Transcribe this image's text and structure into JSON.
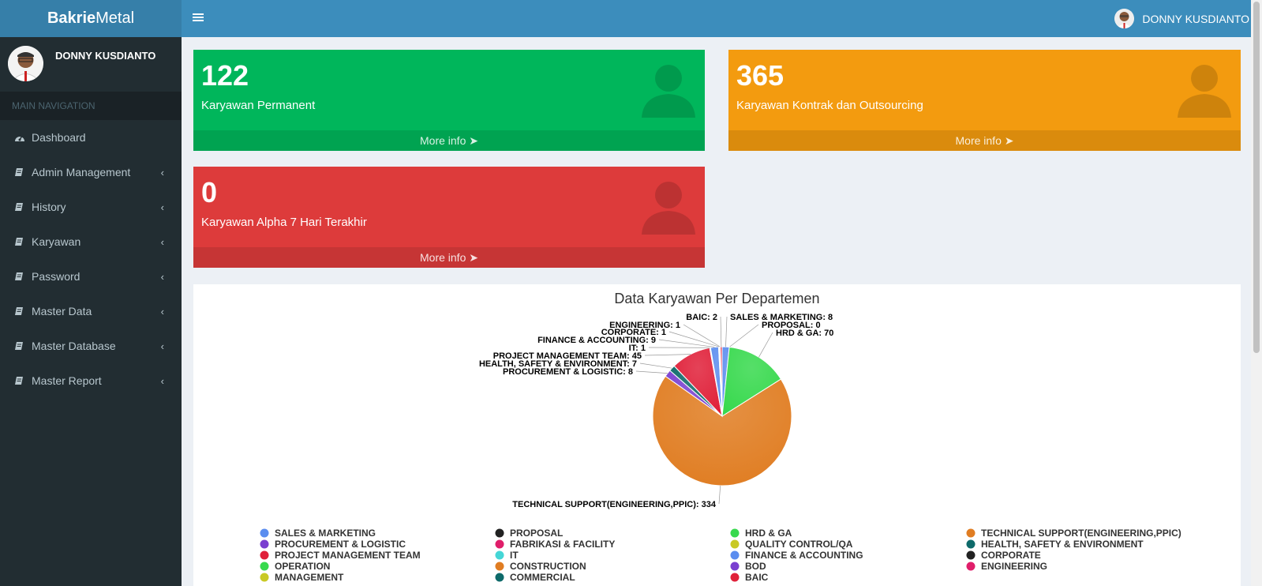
{
  "brand": {
    "bold": "Bakrie",
    "light": "Metal"
  },
  "header": {
    "user_name": "DONNY KUSDIANTO"
  },
  "sidebar": {
    "user_name": "DONNY KUSDIANTO",
    "nav_header": "MAIN NAVIGATION",
    "items": [
      {
        "label": "Dashboard",
        "icon": "dashboard-icon",
        "has_submenu": false
      },
      {
        "label": "Admin Management",
        "icon": "book-icon",
        "has_submenu": true
      },
      {
        "label": "History",
        "icon": "book-icon",
        "has_submenu": true
      },
      {
        "label": "Karyawan",
        "icon": "book-icon",
        "has_submenu": true
      },
      {
        "label": "Password",
        "icon": "book-icon",
        "has_submenu": true
      },
      {
        "label": "Master Data",
        "icon": "book-icon",
        "has_submenu": true
      },
      {
        "label": "Master Database",
        "icon": "book-icon",
        "has_submenu": true
      },
      {
        "label": "Master Report",
        "icon": "book-icon",
        "has_submenu": true
      }
    ]
  },
  "stats": [
    {
      "value": "122",
      "label": "Karyawan Permanent",
      "more": "More info",
      "color": "#00b65b"
    },
    {
      "value": "365",
      "label": "Karyawan Kontrak dan Outsourcing",
      "more": "More info",
      "color": "#f39b0f"
    },
    {
      "value": "0",
      "label": "Karyawan Alpha 7 Hari Terakhir",
      "more": "More info",
      "color": "#dd3b3b"
    }
  ],
  "chart_data": {
    "type": "pie",
    "title": "Data Karyawan Per Departemen",
    "slices": [
      {
        "name": "SALES & MARKETING",
        "value": 8,
        "color": "#5b8def"
      },
      {
        "name": "PROPOSAL",
        "value": 0,
        "color": "#222222"
      },
      {
        "name": "HRD & GA",
        "value": 70,
        "color": "#38d94e"
      },
      {
        "name": "TECHNICAL SUPPORT(ENGINEERING,PPIC)",
        "value": 334,
        "color": "#e07d22"
      },
      {
        "name": "PROCUREMENT & LOGISTIC",
        "value": 8,
        "color": "#7a3fd0"
      },
      {
        "name": "HEALTH, SAFETY & ENVIRONMENT",
        "value": 7,
        "color": "#0e6a6a"
      },
      {
        "name": "PROJECT MANAGEMENT TEAM",
        "value": 45,
        "color": "#e0213a"
      },
      {
        "name": "IT",
        "value": 1,
        "color": "#45d6d6"
      },
      {
        "name": "FINANCE & ACCOUNTING",
        "value": 9,
        "color": "#5b8def"
      },
      {
        "name": "CORPORATE",
        "value": 1,
        "color": "#222222"
      },
      {
        "name": "ENGINEERING",
        "value": 1,
        "color": "#e01e6a"
      },
      {
        "name": "BAIC",
        "value": 2,
        "color": "#e0213a"
      }
    ],
    "legend": [
      {
        "name": "SALES & MARKETING",
        "color": "#5b8def"
      },
      {
        "name": "PROPOSAL",
        "color": "#222222"
      },
      {
        "name": "HRD & GA",
        "color": "#38d94e"
      },
      {
        "name": "TECHNICAL SUPPORT(ENGINEERING,PPIC)",
        "color": "#e07d22"
      },
      {
        "name": "PROCUREMENT & LOGISTIC",
        "color": "#7a3fd0"
      },
      {
        "name": "FABRIKASI & FACILITY",
        "color": "#e01e6a"
      },
      {
        "name": "QUALITY CONTROL/QA",
        "color": "#c9c925"
      },
      {
        "name": "HEALTH, SAFETY & ENVIRONMENT",
        "color": "#0e6a6a"
      },
      {
        "name": "PROJECT MANAGEMENT TEAM",
        "color": "#e0213a"
      },
      {
        "name": "IT",
        "color": "#45d6d6"
      },
      {
        "name": "FINANCE & ACCOUNTING",
        "color": "#5b8def"
      },
      {
        "name": "CORPORATE",
        "color": "#222222"
      },
      {
        "name": "OPERATION",
        "color": "#38d94e"
      },
      {
        "name": "CONSTRUCTION",
        "color": "#e07d22"
      },
      {
        "name": "BOD",
        "color": "#7a3fd0"
      },
      {
        "name": "ENGINEERING",
        "color": "#e01e6a"
      },
      {
        "name": "MANAGEMENT",
        "color": "#c9c925"
      },
      {
        "name": "COMMERCIAL",
        "color": "#0e6a6a"
      },
      {
        "name": "BAIC",
        "color": "#e0213a"
      }
    ],
    "legend_placement": "bottom"
  }
}
